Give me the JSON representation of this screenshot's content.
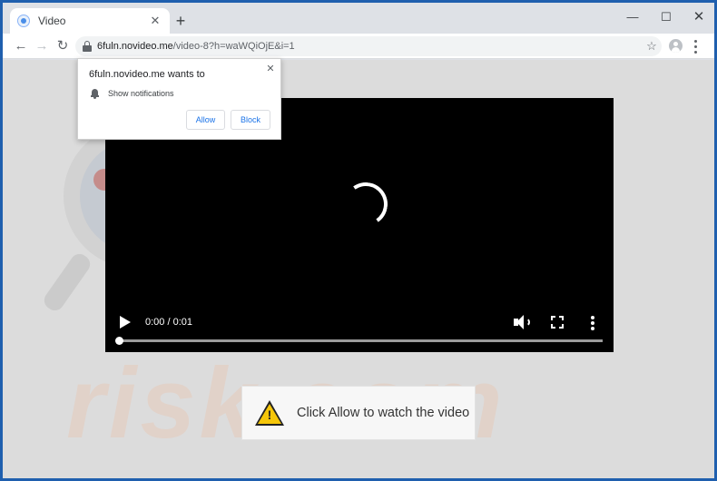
{
  "browser": {
    "tab": {
      "title": "Video",
      "close": "✕"
    },
    "new_tab": "+",
    "window_controls": {
      "minimize": "—",
      "maximize": "☐",
      "close": "✕"
    },
    "nav": {
      "back": "←",
      "forward": "→",
      "reload": "↻"
    },
    "address": {
      "domain": "6fuln.novideo.me",
      "path": "/video-8?h=waWQiOjE&i=1"
    },
    "bookmark_star": "☆"
  },
  "notification_prompt": {
    "title": "6fuln.novideo.me wants to",
    "permission": "Show notifications",
    "allow_label": "Allow",
    "block_label": "Block",
    "close": "✕"
  },
  "video_player": {
    "time": "0:00 / 0:01",
    "progress": 0
  },
  "notice": {
    "icon": "warning-icon",
    "icon_glyph": "!",
    "message": "Click Allow to watch the video"
  },
  "watermark": {
    "text": "risk.com"
  }
}
